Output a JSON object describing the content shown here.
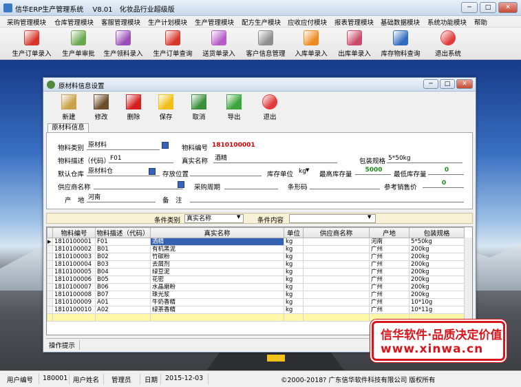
{
  "app": {
    "title": "信华ERP生产管理系统",
    "version": "V8.01",
    "edition": "化妆品行业超级版"
  },
  "menu": [
    "采购管理模块",
    "仓库管理模块",
    "客服管理模块",
    "生产计划模块",
    "生产管理模块",
    "配方生产模块",
    "应收应付模块",
    "报表管理模块",
    "基础数据模块",
    "系统功能模块",
    "帮助"
  ],
  "toolbar": [
    {
      "label": "生产订单录入",
      "icon": "pdf-doc-icon",
      "color": "#d8362b"
    },
    {
      "label": "生产单审批",
      "icon": "approve-doc-icon",
      "color": "#6aa84f"
    },
    {
      "label": "生产领料录入",
      "icon": "material-doc-icon",
      "color": "#9a4fb8"
    },
    {
      "label": "生产订单查询",
      "icon": "pdf-doc-icon",
      "color": "#d8362b"
    },
    {
      "label": "送货单录入",
      "icon": "delivery-doc-icon",
      "color": "#b65bc6"
    },
    {
      "label": "客户信息管理",
      "icon": "customer-doc-icon",
      "color": "#8e8e8e"
    },
    {
      "label": "入库单录入",
      "icon": "flower-icon",
      "color": "#ef8a1e"
    },
    {
      "label": "出库单录入",
      "icon": "brush-doc-icon",
      "color": "#c94a6a"
    },
    {
      "label": "库存物料查询",
      "icon": "feather-doc-icon",
      "color": "#2f6cc0"
    },
    {
      "label": "退出系统",
      "icon": "exit-circle-icon",
      "color": "#e23b3b"
    }
  ],
  "dialog": {
    "title": "原材料信息设置",
    "buttons": [
      {
        "label": "新建",
        "icon": "clipboard-icon",
        "color": "#c9a24a"
      },
      {
        "label": "修改",
        "icon": "edit-icon",
        "color": "#6b4f2a"
      },
      {
        "label": "删除",
        "icon": "delete-x-icon",
        "color": "#d61f1f"
      },
      {
        "label": "保存",
        "icon": "save-disk-icon",
        "color": "#f0c018"
      },
      {
        "label": "取消",
        "icon": "undo-arrow-icon",
        "color": "#3b8f3b"
      },
      {
        "label": "导出",
        "icon": "export-arrow-icon",
        "color": "#3aa53a"
      },
      {
        "label": "退出",
        "icon": "exit-circle-icon",
        "color": "#e23b3b"
      }
    ],
    "tab": "原材料信息",
    "form": {
      "category_label": "物料类别",
      "category": "原材料",
      "code_label": "物料编号",
      "code": "1810100001",
      "desc_label": "物料描述（代码）",
      "desc": "F01",
      "realname_label": "真实名称",
      "realname": "酒精",
      "pack_label": "包装规格",
      "pack": "5*50kg",
      "warehouse_label": "默认仓库",
      "warehouse": "原材料仓",
      "location_label": "存放位置",
      "location": "",
      "unit_label": "库存单位",
      "unit": "kg",
      "max_label": "最高库存量",
      "max": "5000",
      "min_label": "最低库存量",
      "min": "0",
      "supplier_label": "供应商名称",
      "supplier": "",
      "cycle_label": "采购周期",
      "cycle": "",
      "barcode_label": "条形码",
      "barcode": "",
      "price_label": "参考销售价",
      "price": "0",
      "origin_label": "产　地",
      "origin": "河南",
      "note_label": "备　注",
      "note": ""
    },
    "condition": {
      "type_label": "条件类别",
      "type": "真实名称",
      "content_label": "条件内容",
      "content": ""
    },
    "grid": {
      "columns": [
        "物料编号",
        "物料描述（代码）",
        "真实名称",
        "单位",
        "供应商名称",
        "产地",
        "包装规格"
      ],
      "rows": [
        [
          "1810100001",
          "F01",
          "酒精",
          "kg",
          "",
          "河南",
          "5*50kg"
        ],
        [
          "1810100002",
          "B01",
          "有机黑泥",
          "kg",
          "",
          "广州",
          "200kg"
        ],
        [
          "1810100003",
          "B02",
          "竹碳粉",
          "kg",
          "",
          "广州",
          "200kg"
        ],
        [
          "1810100004",
          "B03",
          "去屑剂",
          "kg",
          "",
          "广州",
          "200kg"
        ],
        [
          "1810100005",
          "B04",
          "绿豆泥",
          "kg",
          "",
          "广州",
          "200kg"
        ],
        [
          "1810100006",
          "B05",
          "花密",
          "kg",
          "",
          "广州",
          "200kg"
        ],
        [
          "1810100007",
          "B06",
          "水晶磨粉",
          "kg",
          "",
          "广州",
          "200kg"
        ],
        [
          "1810100008",
          "B07",
          "珠光浆",
          "kg",
          "",
          "广州",
          "200kg"
        ],
        [
          "1810100009",
          "A01",
          "牛奶香精",
          "kg",
          "",
          "广州",
          "10*10g"
        ],
        [
          "1810100010",
          "A02",
          "绿茶香精",
          "kg",
          "",
          "广州",
          "10*11g"
        ]
      ]
    },
    "hint": "操作提示"
  },
  "status": {
    "user_no_label": "用户编号",
    "user_no": "180001",
    "user_name_label": "用户姓名",
    "user_name": "管理员",
    "date_label": "日期",
    "date": "2015-12-03",
    "copyright": "©2000-2018?   广东信华软件科技有限公司   版权所有"
  },
  "stamp": {
    "slogan": "信华软件·品质决定价值",
    "site": "www.xinwa.cn"
  }
}
